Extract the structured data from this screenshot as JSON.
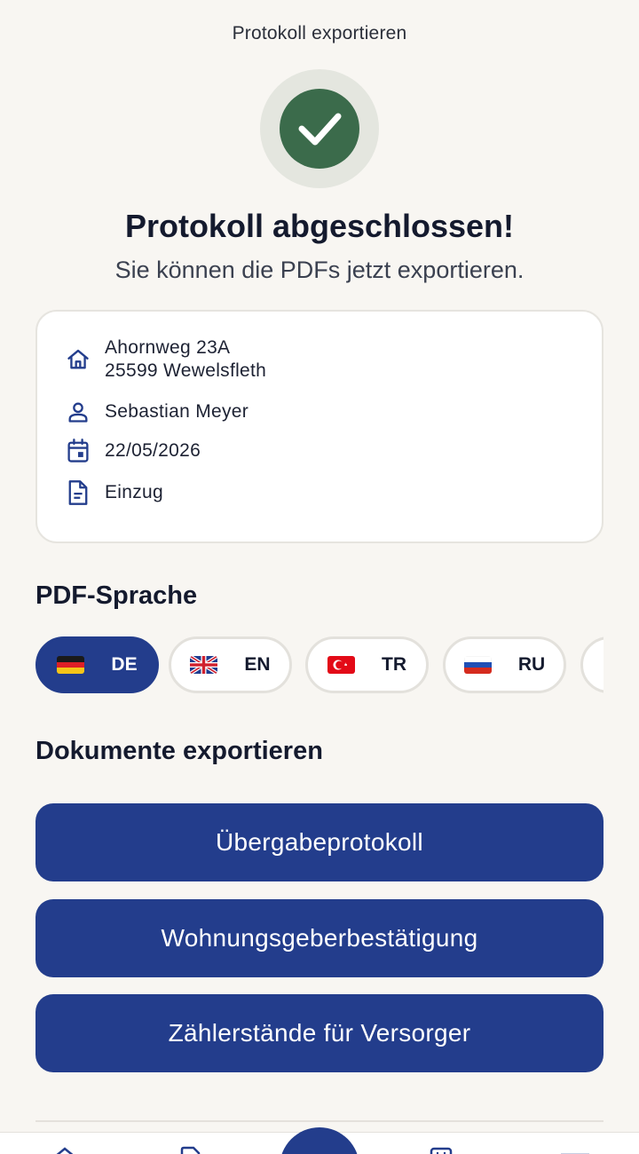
{
  "header": {
    "title": "Protokoll exportieren"
  },
  "status": {
    "headline": "Protokoll abgeschlossen!",
    "subline": "Sie können die PDFs jetzt exportieren."
  },
  "info": {
    "address_line1": "Ahornweg 23A",
    "address_line2": "25599 Wewelsfleth",
    "person": "Sebastian Meyer",
    "date": "22/05/2026",
    "type": "Einzug"
  },
  "language": {
    "title": "PDF-Sprache",
    "selected": "DE",
    "options": [
      {
        "code": "DE",
        "flag": "germany-flag"
      },
      {
        "code": "EN",
        "flag": "uk-flag"
      },
      {
        "code": "TR",
        "flag": "turkey-flag"
      },
      {
        "code": "RU",
        "flag": "russia-flag"
      }
    ]
  },
  "export": {
    "title": "Dokumente exportieren",
    "buttons": [
      "Übergabeprotokoll",
      "Wohnungsgeberbestätigung",
      "Zählerstände für Versorger"
    ]
  },
  "colors": {
    "primary": "#233d8c",
    "success": "#3b6b4b",
    "background": "#f8f6f2"
  },
  "icons": {
    "address": "home-icon",
    "person": "person-icon",
    "date": "calendar-icon",
    "type": "document-icon"
  }
}
